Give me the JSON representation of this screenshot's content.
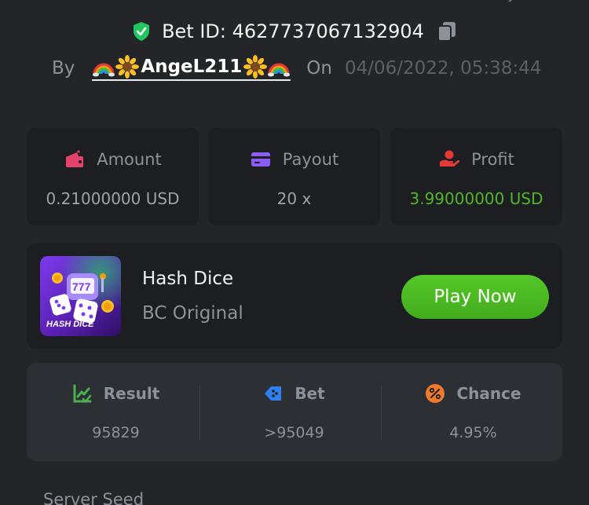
{
  "header": {
    "bet_id_label": "Bet ID: 4627737067132904",
    "by_label": "By",
    "username": "AngeL211",
    "on_label": "On",
    "datetime": "04/06/2022, 05:38:44",
    "icons": [
      "shield-check-icon",
      "copy-icon",
      "rainbow-icon",
      "sunflower-icon"
    ]
  },
  "stats": {
    "amount": {
      "label": "Amount",
      "value": "0.21000000 USD",
      "icon": "wallet-icon"
    },
    "payout": {
      "label": "Payout",
      "value": "20 x",
      "icon": "card-icon"
    },
    "profit": {
      "label": "Profit",
      "value": "3.99000000 USD",
      "icon": "hand-profit-icon"
    }
  },
  "game": {
    "thumb_label": "HASH DICE",
    "title": "Hash Dice",
    "subtitle": "BC Original",
    "play_label": "Play Now"
  },
  "result": {
    "result": {
      "label": "Result",
      "value": "95829",
      "icon": "chart-check-icon"
    },
    "bet": {
      "label": "Bet",
      "value": ">95049",
      "icon": "dice-tag-icon"
    },
    "chance": {
      "label": "Chance",
      "value": "4.95%",
      "icon": "percent-icon"
    }
  },
  "server_seed_label": "Server Seed",
  "colors": {
    "background": "#232528",
    "card": "#1c1e21",
    "accent_green": "#52b52a",
    "button_green": "#4cbb22",
    "amount_pink": "#e5426b",
    "payout_purple": "#8b5cf6",
    "profit_red": "#e53935",
    "result_green": "#4caf50",
    "bet_blue": "#2f80ed",
    "chance_orange": "#f07a2a"
  }
}
